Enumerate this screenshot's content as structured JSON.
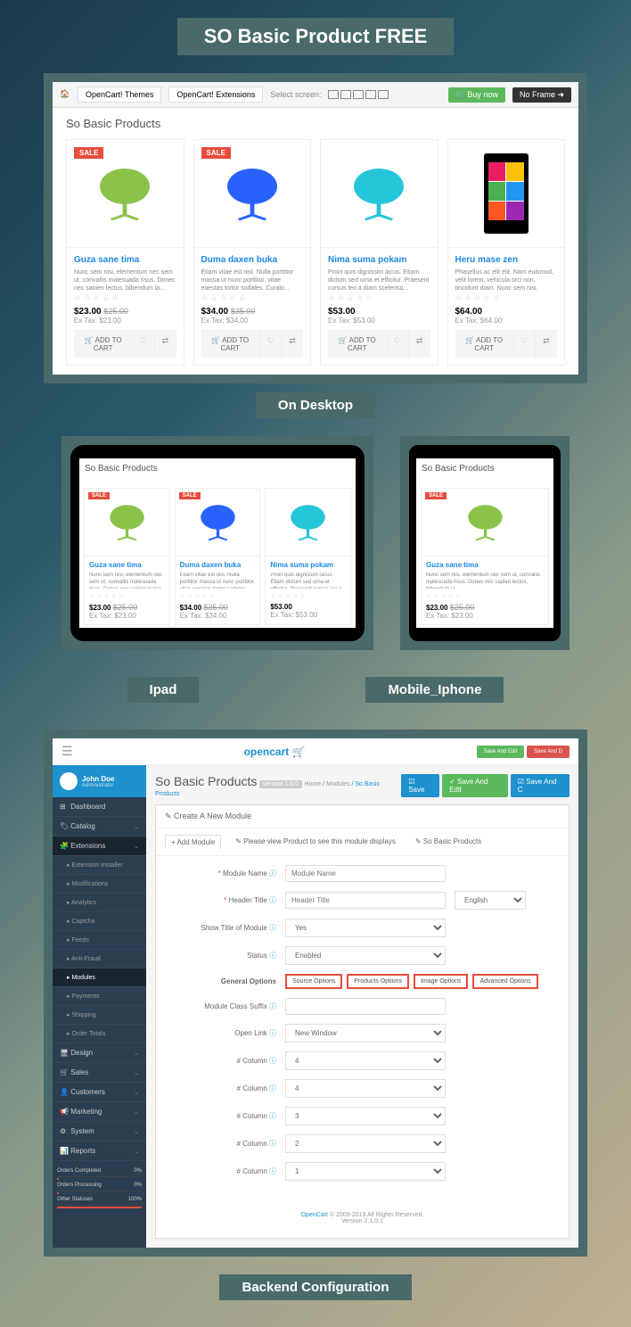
{
  "title": "SO Basic Product FREE",
  "labels": {
    "desktop": "On Desktop",
    "ipad": "Ipad",
    "mobile": "Mobile_Iphone",
    "backend": "Backend Configuration"
  },
  "toolbar": {
    "themes": "OpenCart! Themes",
    "extensions": "OpenCart! Extensions",
    "select_screen": "Select screen:",
    "buy": "🛒 Buy now",
    "frame": "No Frame ➜"
  },
  "page_title": "So Basic Products",
  "products": [
    {
      "name": "Guza sane tima",
      "desc": "Nunc sem nisi, elementum nec sem ut, convallis malesuada risus. Donec nec sapien lectus, bibendum la...",
      "sale": true,
      "price": "$23.00",
      "old": "$25.00",
      "tax": "Ex Tax: $23.00",
      "img": "green"
    },
    {
      "name": "Duma daxen buka",
      "desc": "Etiam vitae est nisl. Nulla porttitor massa ut nunc porttitor, vitae egestas tortor sodales. Curabi...",
      "sale": true,
      "price": "$34.00",
      "old": "$35.00",
      "tax": "Ex Tax: $34.00",
      "img": "blue"
    },
    {
      "name": "Nima suma pokam",
      "desc": "Proin quis dignissim lacus. Etiam dictum sed urna et efficitur. Praesent cursus leo a diam scelerisq...",
      "sale": false,
      "price": "$53.00",
      "old": "",
      "tax": "Ex Tax: $53.00",
      "img": "teal"
    },
    {
      "name": "Heru mase zen",
      "desc": "Phasellus ac elit elit. Nam euismod, velit lorem, vehicula orci non, tincidunt diam. Nunc sem nisi, elementum nec sem ut,...",
      "sale": false,
      "price": "$64.00",
      "old": "",
      "tax": "Ex Tax: $64.00",
      "img": "phone"
    }
  ],
  "add_cart": "🛒 ADD TO CART",
  "admin": {
    "logo": "opencart",
    "user": {
      "name": "John Doe",
      "role": "Administrator"
    },
    "menu": [
      {
        "label": "Dashboard",
        "ico": "⊞"
      },
      {
        "label": "Catalog",
        "ico": "🏷",
        "chev": true
      },
      {
        "label": "Extensions",
        "ico": "🧩",
        "chev": true,
        "dark": true
      },
      {
        "label": "Extension Installer",
        "sub": true
      },
      {
        "label": "Modifications",
        "sub": true
      },
      {
        "label": "Analytics",
        "sub": true
      },
      {
        "label": "Captcha",
        "sub": true
      },
      {
        "label": "Feeds",
        "sub": true
      },
      {
        "label": "Anti-Fraud",
        "sub": true
      },
      {
        "label": "Modules",
        "sub": true,
        "active": true
      },
      {
        "label": "Payments",
        "sub": true
      },
      {
        "label": "Shipping",
        "sub": true
      },
      {
        "label": "Order Totals",
        "sub": true
      },
      {
        "label": "Design",
        "ico": "🖥",
        "chev": true
      },
      {
        "label": "Sales",
        "ico": "🛒",
        "chev": true
      },
      {
        "label": "Customers",
        "ico": "👤",
        "chev": true
      },
      {
        "label": "Marketing",
        "ico": "📢",
        "chev": true
      },
      {
        "label": "System",
        "ico": "⚙",
        "chev": true
      },
      {
        "label": "Reports",
        "ico": "📊",
        "chev": true
      }
    ],
    "stats": [
      {
        "label": "Orders Completed",
        "val": "0%"
      },
      {
        "label": "Orders Processing",
        "val": "0%"
      },
      {
        "label": "Other Statuses",
        "val": "100%"
      }
    ],
    "main_title": "So Basic Products",
    "version": "version 1.0.0",
    "crumbs": {
      "home": "Home",
      "mod": "Modules",
      "cur": "So Basic Products"
    },
    "buttons": {
      "save": "☑ Save",
      "save_edit": "✓ Save And Edit",
      "save_new": "☑ Save And C"
    },
    "form_title": "✎ Create A New Module",
    "tabs": {
      "add": "+ Add Module",
      "info": "✎ Please view Product to see this module displays",
      "cur": "✎ So Basic Products"
    },
    "fields": {
      "module_name": {
        "label": "Module Name",
        "ph": "Module Name",
        "req": true
      },
      "header_title": {
        "label": "Header Title",
        "ph": "Header Title",
        "req": true,
        "lang": "English"
      },
      "show_title": {
        "label": "Show Title of Module",
        "val": "Yes"
      },
      "status": {
        "label": "Status",
        "val": "Enabled"
      },
      "general": {
        "label": "General Options",
        "opts": [
          "Source Options",
          "Products Options",
          "Image Options",
          "Advanced Options"
        ]
      },
      "suffix": {
        "label": "Module Class Suffix"
      },
      "open_link": {
        "label": "Open Link",
        "val": "New Window"
      },
      "col1": {
        "label": "# Column",
        "val": "4"
      },
      "col2": {
        "label": "# Column",
        "val": "4"
      },
      "col3": {
        "label": "# Column",
        "val": "3"
      },
      "col4": {
        "label": "# Column",
        "val": "2"
      },
      "col5": {
        "label": "# Column",
        "val": "1"
      }
    },
    "footer": {
      "link": "OpenCart",
      "text": " © 2009-2019 All Rights Reserved.",
      "ver": "Version 2.1.0.1"
    }
  }
}
